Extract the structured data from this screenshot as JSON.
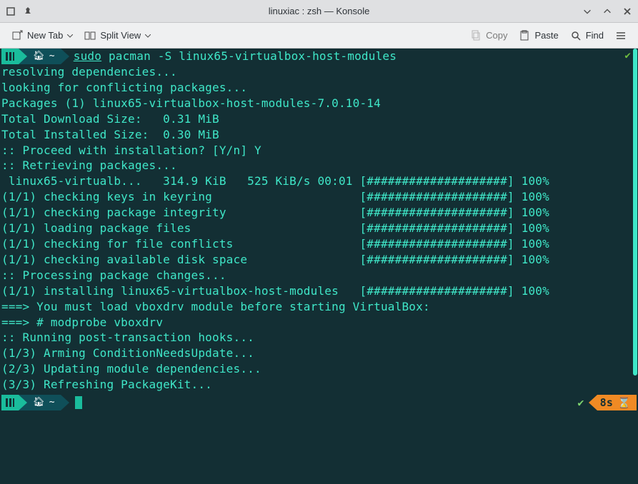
{
  "title": "linuxiac : zsh — Konsole",
  "toolbar": {
    "new_tab": "New Tab",
    "split_view": "Split View",
    "copy": "Copy",
    "paste": "Paste",
    "find": "Find"
  },
  "prompt": {
    "home_indicator": "~",
    "sudo": "sudo",
    "pacman": "pacman",
    "args": " -S linux65-virtualbox-host-modules"
  },
  "output": {
    "l1": "resolving dependencies...",
    "l2": "looking for conflicting packages...",
    "l3": "",
    "l4": "Packages (1) linux65-virtualbox-host-modules-7.0.10-14",
    "l5": "",
    "l6": "Total Download Size:   0.31 MiB",
    "l7": "Total Installed Size:  0.30 MiB",
    "l8": "",
    "l9": ":: Proceed with installation? [Y/n] Y",
    "l10": ":: Retrieving packages...",
    "l11": " linux65-virtualb...   314.9 KiB   525 KiB/s 00:01 [####################] 100%",
    "l12": "(1/1) checking keys in keyring                     [####################] 100%",
    "l13": "(1/1) checking package integrity                   [####################] 100%",
    "l14": "(1/1) loading package files                        [####################] 100%",
    "l15": "(1/1) checking for file conflicts                  [####################] 100%",
    "l16": "(1/1) checking available disk space                [####################] 100%",
    "l17": ":: Processing package changes...",
    "l18": "(1/1) installing linux65-virtualbox-host-modules   [####################] 100%",
    "l19": "===> You must load vboxdrv module before starting VirtualBox:",
    "l20": "===> # modprobe vboxdrv",
    "l21": ":: Running post-transaction hooks...",
    "l22": "(1/3) Arming ConditionNeedsUpdate...",
    "l23": "(2/3) Updating module dependencies...",
    "l24": "(3/3) Refreshing PackageKit..."
  },
  "status": {
    "time": "8s"
  }
}
